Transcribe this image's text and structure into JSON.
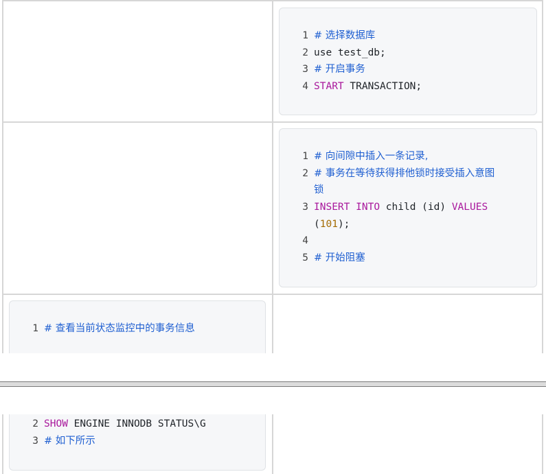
{
  "cell_a": {
    "lines": [
      {
        "n": "1",
        "comment": "# 选择数据库"
      },
      {
        "n": "2",
        "plain": "use test_db;"
      },
      {
        "n": "3",
        "comment": "# 开启事务"
      },
      {
        "n": "4",
        "kw": "START",
        "plain": " TRANSACTION;"
      }
    ]
  },
  "cell_b": {
    "lines": [
      {
        "n": "1",
        "comment": "# 向间隙中插入一条记录,"
      },
      {
        "n": "2",
        "comment": "# 事务在等待获得排他锁时接受插入意图"
      },
      {
        "n": "",
        "comment": "锁"
      },
      {
        "n": "3",
        "kw1": "INSERT",
        "kw2": "INTO",
        "plain1": "child (id)",
        "kw3": "VALUES"
      },
      {
        "n": "",
        "p_open": "(",
        "num": "101",
        "p_close": ");"
      },
      {
        "n": "4"
      },
      {
        "n": "5",
        "comment": "# 开始阻塞"
      }
    ]
  },
  "cell_c": {
    "lines": [
      {
        "n": "1",
        "comment": "# 查看当前状态监控中的事务信息"
      },
      {
        "n": "2",
        "kw": "SHOW",
        "plain": " ENGINE INNODB STATUS\\G"
      },
      {
        "n": "3",
        "comment": "# 如下所示"
      }
    ]
  },
  "colors": {
    "comment": "#1f5fd1",
    "keyword": "#a9189c",
    "number": "#a36a00",
    "code_bg": "#f6f7f9",
    "border": "#d6d6d6"
  }
}
